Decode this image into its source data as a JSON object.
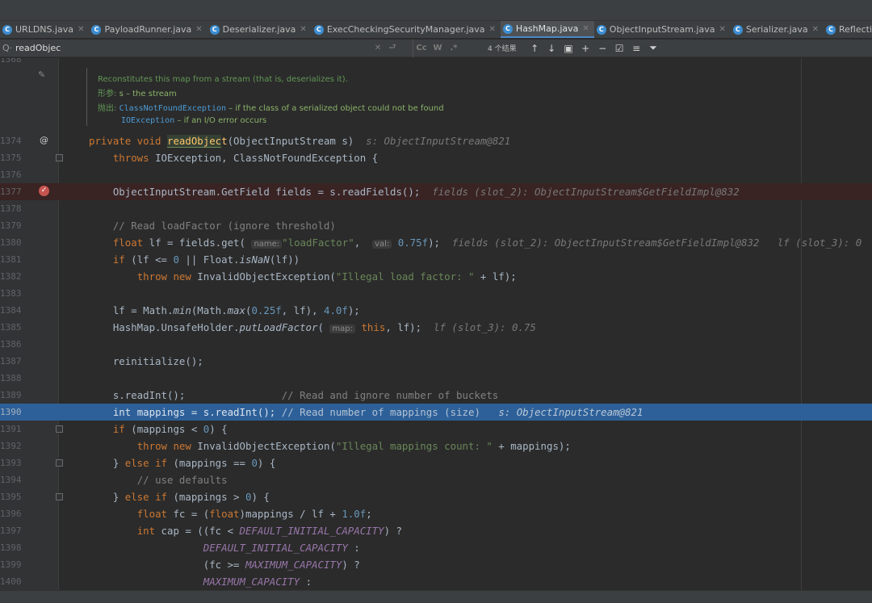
{
  "tabs": [
    {
      "label": "URLDNS.java",
      "active": false
    },
    {
      "label": "PayloadRunner.java",
      "active": false
    },
    {
      "label": "Deserializer.java",
      "active": false
    },
    {
      "label": "ExecCheckingSecurityManager.java",
      "active": false
    },
    {
      "label": "HashMap.java",
      "active": true
    },
    {
      "label": "ObjectInputStream.java",
      "active": false
    },
    {
      "label": "Serializer.java",
      "active": false
    },
    {
      "label": "Reflections.java",
      "active": false
    }
  ],
  "find": {
    "query": "readObjec",
    "match_case": "Cc",
    "words": "W",
    "regex": ".*",
    "results": "4 个结果"
  },
  "javadoc": {
    "summary": "Reconstitutes this map from a stream (that is, deserializes it).",
    "param_label": "形参:",
    "param_name": "s",
    "param_desc": " – the stream",
    "throws_label": "抛出:",
    "throws1_name": "ClassNotFoundException",
    "throws1_desc": " – if the class of a serialized object could not be found",
    "throws2_name": "IOException",
    "throws2_desc": " – if an I/O error occurs"
  },
  "editor": {
    "first_line_partial": "1368",
    "current_line": "1390",
    "breakpoint_line": "1377"
  },
  "colors": {
    "background": "#2b2b2b",
    "keyword": "#cc7832",
    "string": "#6a8759",
    "number": "#6897bb",
    "comment": "#808080",
    "current_line": "#2d6099",
    "breakpoint_line": "#3a2323"
  }
}
